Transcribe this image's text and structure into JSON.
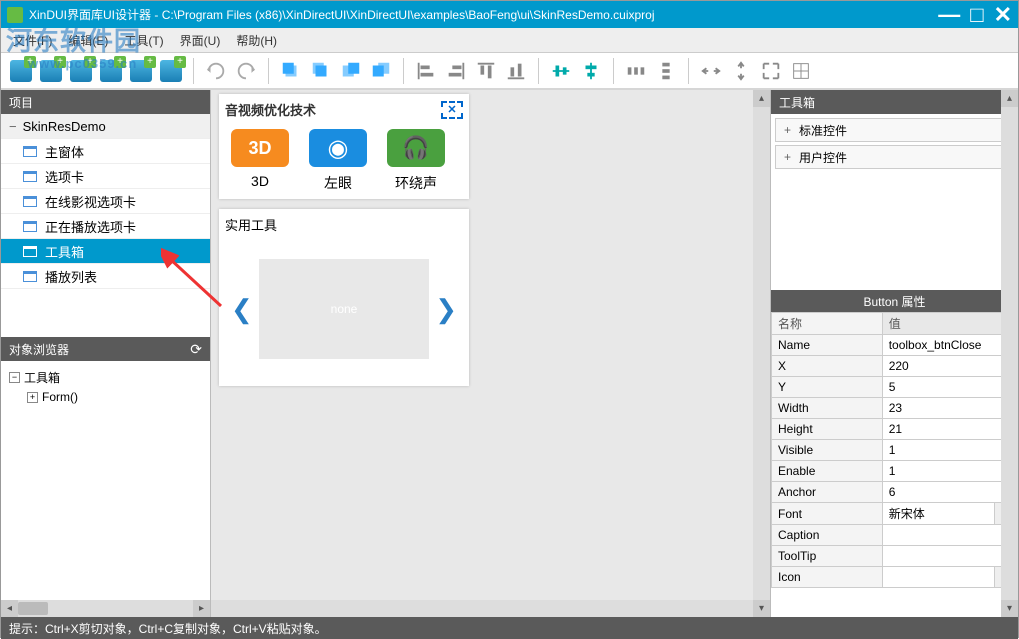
{
  "titlebar": {
    "app": "XinDUI界面库UI设计器",
    "path": "C:\\Program Files (x86)\\XinDirectUI\\XinDirectUI\\examples\\BaoFeng\\ui\\SkinResDemo.cuixproj"
  },
  "watermark": {
    "main": "河东软件园",
    "url": "www.pc0359.cn"
  },
  "menu": {
    "file": "文件(F)",
    "edit": "编辑(E)",
    "tool": "工具(T)",
    "view": "界面(U)",
    "help": "帮助(H)"
  },
  "panels": {
    "project": "项目",
    "objectBrowser": "对象浏览器",
    "toolbox": "工具箱",
    "propHeader": "Button 属性"
  },
  "project": {
    "root": "SkinResDemo",
    "items": [
      "主窗体",
      "选项卡",
      "在线影视选项卡",
      "正在播放选项卡",
      "工具箱",
      "播放列表"
    ],
    "selectedIndex": 4
  },
  "objectTree": {
    "root": "工具箱",
    "child": "Form()"
  },
  "design": {
    "title": "音视频优化技术",
    "icons": [
      {
        "key": "3d",
        "label": "3D",
        "badge": "3D"
      },
      {
        "key": "eye",
        "label": "左眼"
      },
      {
        "key": "surround",
        "label": "环绕声"
      }
    ],
    "utilTitle": "实用工具",
    "slideText": "none"
  },
  "toolbox": {
    "categories": [
      "标准控件",
      "用户控件"
    ]
  },
  "props": {
    "header": {
      "name": "名称",
      "value": "值"
    },
    "rows": [
      {
        "k": "Name",
        "v": "toolbox_btnClose"
      },
      {
        "k": "X",
        "v": "220"
      },
      {
        "k": "Y",
        "v": "5"
      },
      {
        "k": "Width",
        "v": "23"
      },
      {
        "k": "Height",
        "v": "21"
      },
      {
        "k": "Visible",
        "v": "1"
      },
      {
        "k": "Enable",
        "v": "1"
      },
      {
        "k": "Anchor",
        "v": "6"
      },
      {
        "k": "Font",
        "v": "新宋体",
        "btn": true
      },
      {
        "k": "Caption",
        "v": ""
      },
      {
        "k": "ToolTip",
        "v": ""
      },
      {
        "k": "Icon",
        "v": "",
        "btn": true
      }
    ]
  },
  "statusbar": {
    "text": "提示：Ctrl+X剪切对象，Ctrl+C复制对象，Ctrl+V粘贴对象。"
  }
}
